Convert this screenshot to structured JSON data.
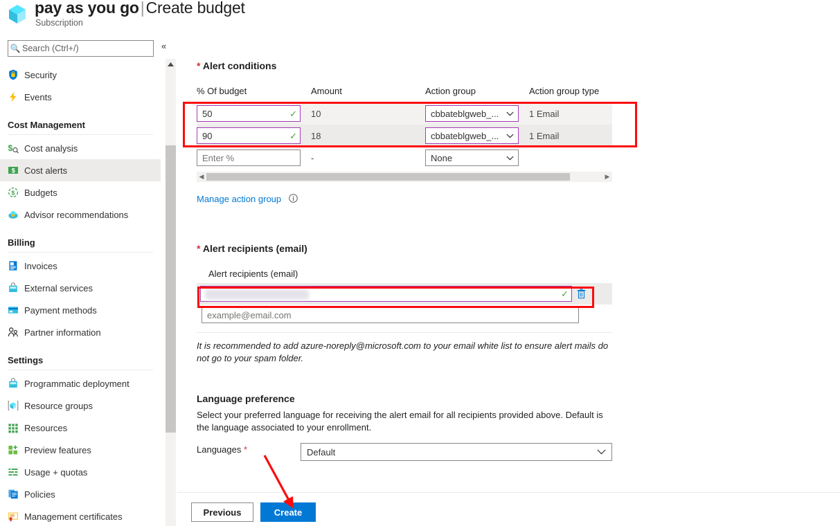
{
  "header": {
    "icon": "subscription-cube-icon",
    "title_bold": "pay as you go",
    "separator": "|",
    "title_rest": "Create budget",
    "subtitle": "Subscription"
  },
  "search": {
    "placeholder": "Search (Ctrl+/)",
    "value": "",
    "icon": "search-icon"
  },
  "collapse": {
    "glyph": "«",
    "name": "collapse-sidebar-icon"
  },
  "sidebar": {
    "items": [
      {
        "type": "item",
        "label": "Security",
        "icon": "shield-icon",
        "selected": false
      },
      {
        "type": "item",
        "label": "Events",
        "icon": "lightning-icon",
        "selected": false
      },
      {
        "type": "group",
        "label": "Cost Management"
      },
      {
        "type": "item",
        "label": "Cost analysis",
        "icon": "dollar-chart-icon",
        "selected": false
      },
      {
        "type": "item",
        "label": "Cost alerts",
        "icon": "dollar-bill-icon",
        "selected": true
      },
      {
        "type": "item",
        "label": "Budgets",
        "icon": "budget-circle-icon",
        "selected": false
      },
      {
        "type": "item",
        "label": "Advisor recommendations",
        "icon": "advisor-cloud-icon",
        "selected": false
      },
      {
        "type": "group",
        "label": "Billing"
      },
      {
        "type": "item",
        "label": "Invoices",
        "icon": "invoice-icon",
        "selected": false
      },
      {
        "type": "item",
        "label": "External services",
        "icon": "external-services-icon",
        "selected": false
      },
      {
        "type": "item",
        "label": "Payment methods",
        "icon": "credit-card-icon",
        "selected": false
      },
      {
        "type": "item",
        "label": "Partner information",
        "icon": "people-icon",
        "selected": false
      },
      {
        "type": "group",
        "label": "Settings"
      },
      {
        "type": "item",
        "label": "Programmatic deployment",
        "icon": "deployment-icon",
        "selected": false
      },
      {
        "type": "item",
        "label": "Resource groups",
        "icon": "resource-group-icon",
        "selected": false
      },
      {
        "type": "item",
        "label": "Resources",
        "icon": "grid-icon",
        "selected": false
      },
      {
        "type": "item",
        "label": "Preview features",
        "icon": "preview-features-icon",
        "selected": false
      },
      {
        "type": "item",
        "label": "Usage + quotas",
        "icon": "usage-quotas-icon",
        "selected": false
      },
      {
        "type": "item",
        "label": "Policies",
        "icon": "policies-icon",
        "selected": false
      },
      {
        "type": "item",
        "label": "Management certificates",
        "icon": "certificate-icon",
        "selected": false
      }
    ]
  },
  "main": {
    "alert_conditions": {
      "title": "Alert conditions",
      "required_marker": "*",
      "columns": [
        "% Of budget",
        "Amount",
        "Action group",
        "Action group type"
      ],
      "rows": [
        {
          "percent": "50",
          "percent_placeholder": "",
          "validated": true,
          "amount": "10",
          "action_group": "cbbateblgweb_...",
          "action_group_type": "1 Email",
          "highlighted": true
        },
        {
          "percent": "90",
          "percent_placeholder": "",
          "validated": true,
          "amount": "18",
          "action_group": "cbbateblgweb_...",
          "action_group_type": "1 Email",
          "highlighted": true
        },
        {
          "percent": "",
          "percent_placeholder": "Enter %",
          "validated": false,
          "amount": "-",
          "action_group": "None",
          "action_group_type": "",
          "highlighted": false
        }
      ],
      "manage_link": "Manage action group",
      "info_icon": "info-icon"
    },
    "alert_recipients": {
      "title": "Alert recipients (email)",
      "required_marker": "*",
      "sub_label": "Alert recipients (email)",
      "entered_email": "",
      "entered_email_redacted": true,
      "validated": true,
      "delete_icon": "trash-icon",
      "add_placeholder": "example@email.com",
      "add_value": "",
      "note": "It is recommended to add azure-noreply@microsoft.com to your email white list to ensure alert mails do not go to your spam folder."
    },
    "language_preference": {
      "title": "Language preference",
      "description": "Select your preferred language for receiving the alert email for all recipients provided above. Default is the language associated to your enrollment.",
      "field_label": "Languages",
      "required_marker": "*",
      "selected": "Default"
    },
    "footer": {
      "previous_label": "Previous",
      "create_label": "Create"
    }
  },
  "annotations": {
    "box_color": "#fb0b0b",
    "arrow_color": "#fb0b0b",
    "boxes": [
      "alert-conditions-rows",
      "alert-recipient-email"
    ],
    "arrow_target": "create-button"
  },
  "colors": {
    "accent_blue": "#0078d4",
    "purple_focus": "#a33bb5",
    "green_check": "#4aa331",
    "required_red": "#d13438",
    "annotation_red": "#fb0b0b",
    "row_alt": "#f3f2f1",
    "selected_nav": "#edebe9"
  }
}
